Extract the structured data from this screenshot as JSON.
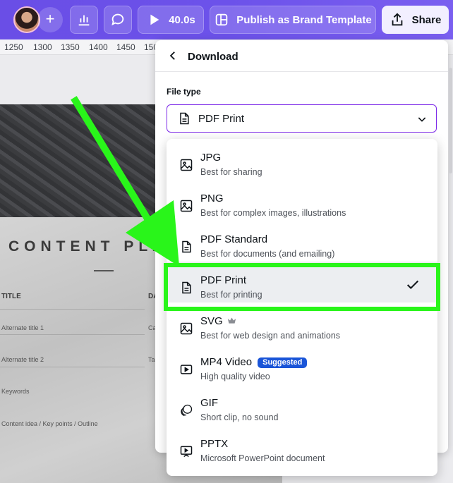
{
  "topbar": {
    "timer_label": "40.0s",
    "publish_label": "Publish as Brand Template",
    "share_label": "Share"
  },
  "ruler": {
    "labels": [
      "1250",
      "1300",
      "1350",
      "1400",
      "1450",
      "150"
    ]
  },
  "design": {
    "title": "CONTENT PLA",
    "col_title": "TITLE",
    "col_date": "DA",
    "rows": [
      "Alternate title 1",
      "Alternate title 2",
      "Keywords",
      "Content idea / Key points / Outline"
    ],
    "row_suffix_1": "Ca",
    "row_suffix_2": "Ta"
  },
  "panel": {
    "title": "Download",
    "filetype_label": "File type",
    "selected_value": "PDF Print"
  },
  "dropdown": {
    "options": [
      {
        "name": "JPG",
        "desc": "Best for sharing",
        "icon": "image-icon"
      },
      {
        "name": "PNG",
        "desc": "Best for complex images, illustrations",
        "icon": "image-icon"
      },
      {
        "name": "PDF Standard",
        "desc": "Best for documents (and emailing)",
        "icon": "document-icon"
      },
      {
        "name": "PDF Print",
        "desc": "Best for printing",
        "icon": "document-icon",
        "selected": true
      },
      {
        "name": "SVG",
        "desc": "Best for web design and animations",
        "icon": "image-icon",
        "premium": true
      },
      {
        "name": "MP4 Video",
        "desc": "High quality video",
        "icon": "video-icon",
        "badge": "Suggested"
      },
      {
        "name": "GIF",
        "desc": "Short clip, no sound",
        "icon": "gif-icon"
      },
      {
        "name": "PPTX",
        "desc": "Microsoft PowerPoint document",
        "icon": "presentation-icon"
      }
    ]
  },
  "colors": {
    "topbar": "#6c52ea",
    "accent_border": "#7d2ae8",
    "annotation": "#29f51a",
    "badge": "#1a55d8"
  }
}
